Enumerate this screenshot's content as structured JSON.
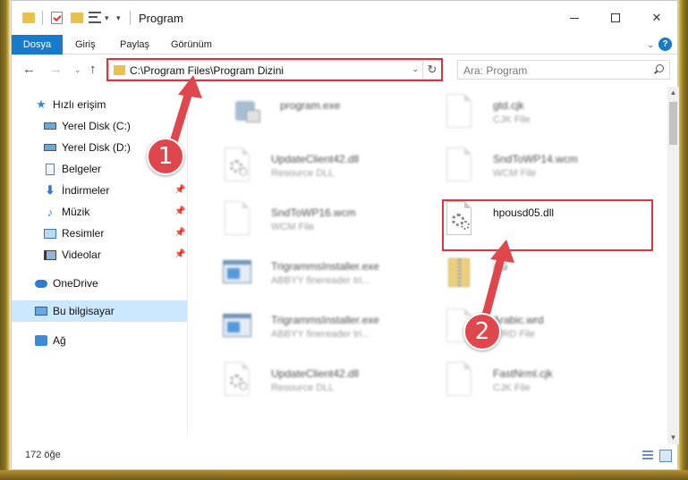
{
  "window": {
    "title": "Program"
  },
  "ribbon": {
    "tabs": [
      "Dosya",
      "Giriş",
      "Paylaş",
      "Görünüm"
    ],
    "help_label": "?"
  },
  "navigation": {
    "address": "C:\\Program Files\\Program Dizini",
    "search_placeholder": "Ara: Program"
  },
  "sidebar": {
    "items": [
      {
        "label": "Hızlı erişim",
        "icon": "star-icon"
      },
      {
        "label": "Yerel Disk (C:)",
        "icon": "disk-icon"
      },
      {
        "label": "Yerel Disk (D:)",
        "icon": "disk-icon"
      },
      {
        "label": "Belgeler",
        "icon": "documents-icon"
      },
      {
        "label": "İndirmeler",
        "icon": "download-icon"
      },
      {
        "label": "Müzik",
        "icon": "music-icon"
      },
      {
        "label": "Resimler",
        "icon": "pictures-icon"
      },
      {
        "label": "Videolar",
        "icon": "videos-icon"
      },
      {
        "label": "OneDrive",
        "icon": "cloud-icon"
      },
      {
        "label": "Bu bilgisayar",
        "icon": "computer-icon"
      },
      {
        "label": "Ağ",
        "icon": "network-icon"
      }
    ]
  },
  "files": [
    {
      "name": "program.exe",
      "type": ""
    },
    {
      "name": "gtd.cjk",
      "type": "CJK File"
    },
    {
      "name": "UpdateClient42.dll",
      "type": "Resource DLL"
    },
    {
      "name": "SndToWP14.wcm",
      "type": "WCM File"
    },
    {
      "name": "SndToWP16.wcm",
      "type": "WCM File"
    },
    {
      "name": "hpousd05.dll",
      "type": ""
    },
    {
      "name": "TrigrammsInstaller.exe",
      "type": "ABBYY finereader tri..."
    },
    {
      "name": "xtu",
      "type": ""
    },
    {
      "name": "TrigrammsInstaller.exe",
      "type": "ABBYY finereader tri..."
    },
    {
      "name": "Arabic.wrd",
      "type": "WRD File"
    },
    {
      "name": "UpdateClient42.dll",
      "type": "Resource DLL"
    },
    {
      "name": "FastNrml.cjk",
      "type": "CJK File"
    }
  ],
  "status": {
    "item_count": "172 öğe"
  },
  "annotations": {
    "step1": "1",
    "step2": "2",
    "color": "#e0474c"
  }
}
